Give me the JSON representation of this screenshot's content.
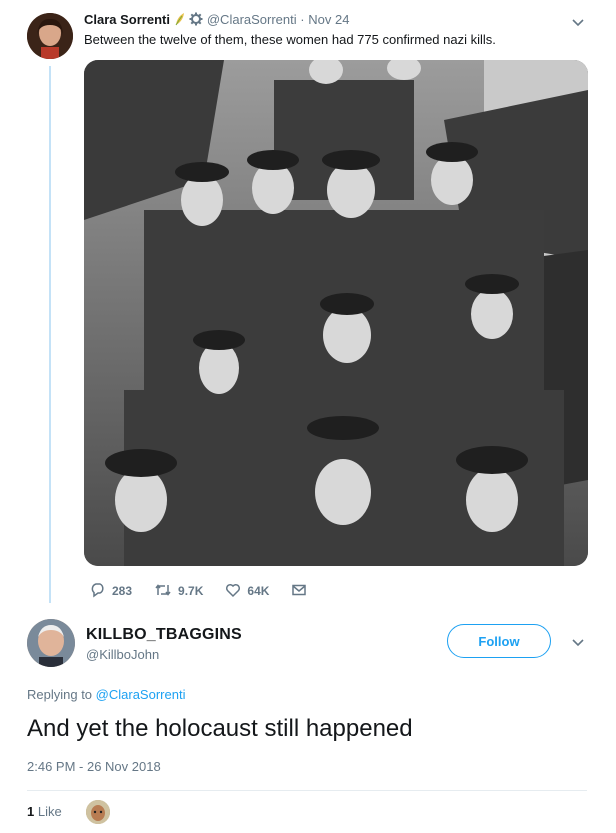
{
  "tweet": {
    "author_name": "Clara Sorrenti",
    "author_handle": "@ClaraSorrenti",
    "separator": "·",
    "date": "Nov 24",
    "text": "Between the twelve of them, these women had 775 confirmed nazi kills.",
    "reply_count": "283",
    "retweet_count": "9.7K",
    "like_count": "64K"
  },
  "reply": {
    "author_name": "KILLBO_TBAGGINS",
    "author_handle": "@KillboJohn",
    "follow_label": "Follow",
    "replying_prefix": "Replying to",
    "replying_to": "@ClaraSorrenti",
    "text": "And yet the holocaust still happened",
    "timestamp": "2:46 PM - 26 Nov 2018",
    "like_count": "1",
    "like_label": "Like"
  },
  "colors": {
    "accent": "#1da1f2",
    "thread_line": "#c4e2f7",
    "secondary_text": "#657786",
    "primary_text": "#14171a"
  },
  "icons": [
    "leaf-icon",
    "gear-icon",
    "chevron-down-icon",
    "reply-icon",
    "retweet-icon",
    "heart-icon",
    "envelope-icon"
  ]
}
